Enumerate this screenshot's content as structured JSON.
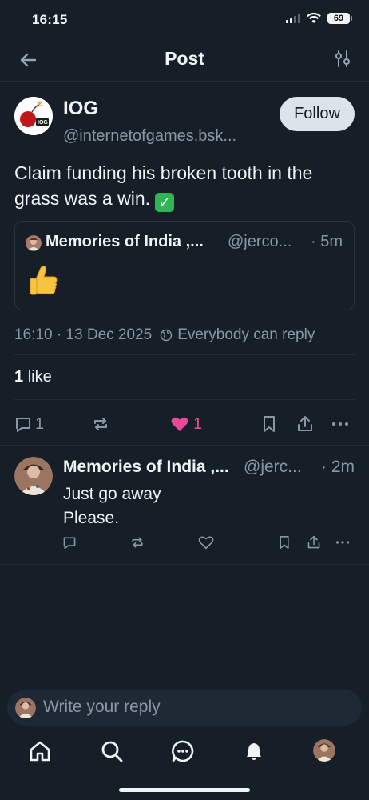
{
  "status_bar": {
    "time": "16:15",
    "battery": "69"
  },
  "header": {
    "title": "Post"
  },
  "post": {
    "author_name": "IOG",
    "author_handle": "@internetofgames.bsk...",
    "follow_label": "Follow",
    "text": "Claim funding his broken tooth in the grass was a win.",
    "text_emoji": "✅",
    "quote": {
      "author_name": "Memories of India ,...",
      "author_handle": "@jerco...",
      "time": "· 5m",
      "emoji": "👍"
    },
    "timestamp": "16:10 · 13 Dec 2025",
    "reply_setting": "Everybody can reply",
    "likes_count": "1",
    "likes_label": "like",
    "reply_count": "1",
    "like_action_count": "1"
  },
  "reply": {
    "author_name": "Memories of India ,...",
    "author_handle": "@jerc...",
    "time": "· 2m",
    "line1": "Just go away",
    "line2": "Please."
  },
  "composer": {
    "placeholder": "Write your reply"
  },
  "icons": {
    "back": "arrow-left-icon",
    "filter": "sliders-icon",
    "reply": "speech-bubble-icon",
    "repost": "repost-icon",
    "like": "heart-icon",
    "bookmark": "bookmark-icon",
    "share": "share-icon",
    "more": "ellipsis-icon",
    "globe": "globe-icon",
    "home": "home-icon",
    "search": "search-icon",
    "chat": "chat-icon",
    "notifications": "bell-icon"
  },
  "colors": {
    "background": "#161e27",
    "like_active": "#ec4899",
    "muted": "#8c97a6"
  }
}
